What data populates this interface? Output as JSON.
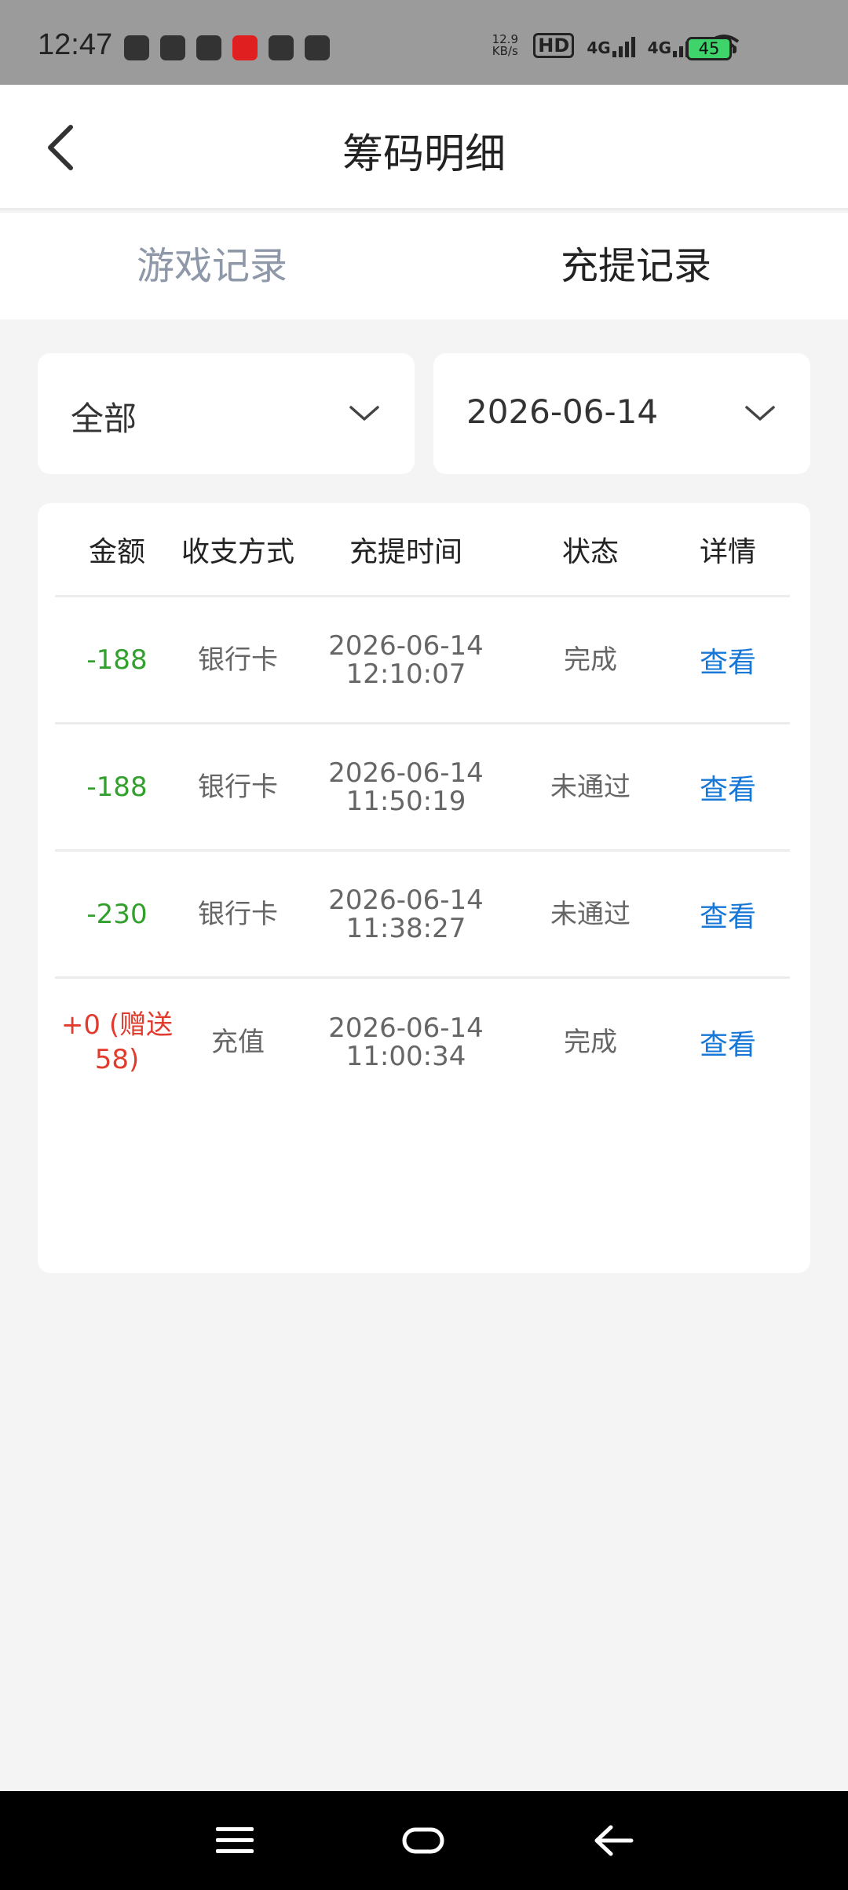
{
  "status_bar": {
    "time": "12:47",
    "speed_value": "12.9",
    "speed_unit": "KB/s",
    "hd": "HD",
    "net1": "4G",
    "net2": "4G",
    "battery": "45"
  },
  "header": {
    "title": "筹码明细",
    "back_icon": "chevron-left-icon"
  },
  "tabs": [
    {
      "label": "游戏记录",
      "active": false
    },
    {
      "label": "充提记录",
      "active": true
    }
  ],
  "filters": {
    "type_value": "全部",
    "date_value": "2026-06-14"
  },
  "table": {
    "columns": [
      "金额",
      "收支方式",
      "充提时间",
      "状态",
      "详情"
    ],
    "rows": [
      {
        "amount": "-188",
        "method": "银行卡",
        "date": "2026-06-14",
        "time": "12:10:07",
        "status": "完成",
        "detail": "查看"
      },
      {
        "amount": "-188",
        "method": "银行卡",
        "date": "2026-06-14",
        "time": "11:50:19",
        "status": "未通过",
        "detail": "查看"
      },
      {
        "amount": "-230",
        "method": "银行卡",
        "date": "2026-06-14",
        "time": "11:38:27",
        "status": "未通过",
        "detail": "查看"
      },
      {
        "amount_line1": "+0 (赠送",
        "amount_line2": "58)",
        "method": "充值",
        "date": "2026-06-14",
        "time": "11:00:34",
        "status": "完成",
        "detail": "查看"
      }
    ]
  },
  "colors": {
    "negative_amount": "#32a02d",
    "positive_amount": "#e13b2e",
    "link": "#1677d6",
    "inactive_tab": "#8e98a8"
  }
}
